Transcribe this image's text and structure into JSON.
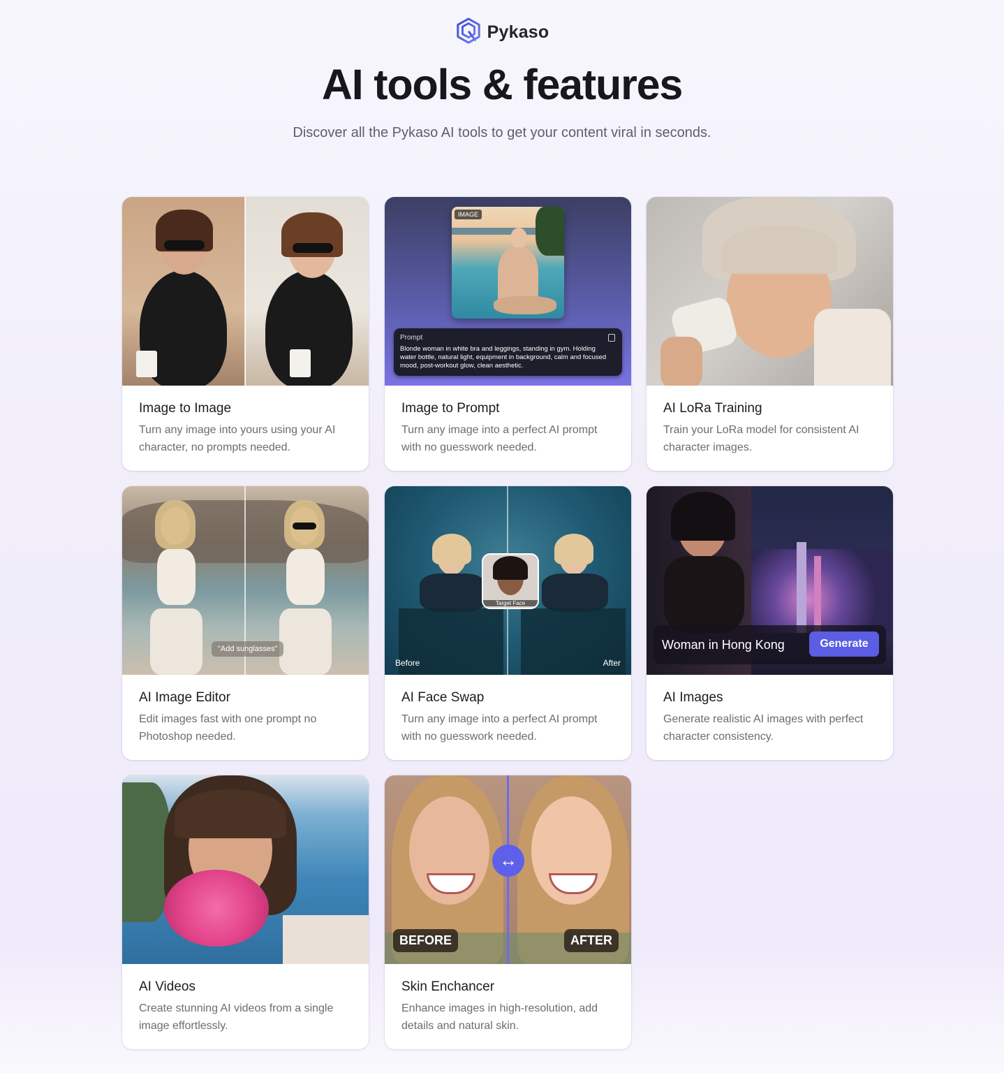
{
  "brand": {
    "name": "Pykaso",
    "logo_icon": "pykaso-hexagon-logo",
    "accent": "#5b5de3"
  },
  "hero": {
    "title": "AI tools & features",
    "subtitle": "Discover all the Pykaso AI tools to get your content viral in seconds."
  },
  "cards": [
    {
      "title": "Image to Image",
      "desc": "Turn any image into yours using your AI character, no prompts needed."
    },
    {
      "title": "Image to Prompt",
      "desc": "Turn any image into a perfect AI prompt with no guesswork needed.",
      "image_tag": "IMAGE",
      "prompt_label": "Prompt",
      "prompt_text": "Blonde woman in white bra and leggings, standing in gym. Holding water bottle, natural light, equipment in background, calm and focused mood, post-workout glow, clean aesthetic."
    },
    {
      "title": "AI LoRa Training",
      "desc": "Train your LoRa model for consistent AI character images."
    },
    {
      "title": "AI Image Editor",
      "desc": "Edit images fast with one prompt no Photoshop needed.",
      "chip": "\"Add sunglasses\""
    },
    {
      "title": "AI Face Swap",
      "desc": "Turn any image into a perfect AI prompt with no guesswork needed.",
      "target_label": "Target Face",
      "before": "Before",
      "after": "After"
    },
    {
      "title": "AI Images",
      "desc": "Generate realistic AI images with perfect character consistency.",
      "prompt_value": "Woman in Hong Kong",
      "button": "Generate"
    },
    {
      "title": "AI Videos",
      "desc": "Create stunning AI videos from a single image effortlessly."
    },
    {
      "title": "Skin Enchancer",
      "desc": "Enhance images in high-resolution, add details and natural skin.",
      "before": "BEFORE",
      "after": "AFTER",
      "slider_icon": "double-arrow-icon"
    }
  ]
}
